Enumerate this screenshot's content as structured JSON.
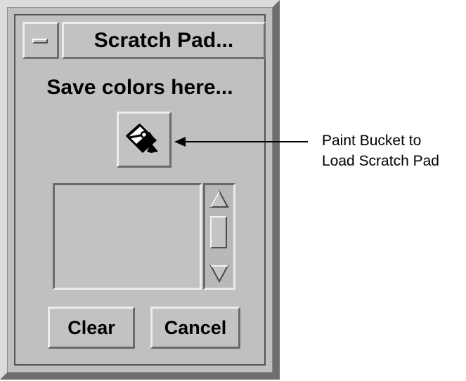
{
  "window": {
    "title": "Scratch Pad...",
    "menu_icon": "window-menu-icon"
  },
  "main": {
    "heading": "Save colors here...",
    "bucket_icon": "paint-bucket-icon"
  },
  "scrollbar": {
    "up_icon": "arrow-up-icon",
    "down_icon": "arrow-down-icon"
  },
  "buttons": {
    "clear_label": "Clear",
    "cancel_label": "Cancel"
  },
  "callout": {
    "line1": "Paint Bucket to",
    "line2": "Load Scratch Pad"
  }
}
